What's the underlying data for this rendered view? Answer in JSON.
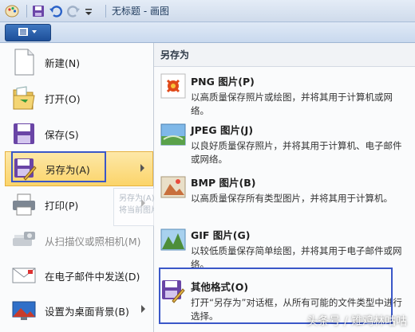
{
  "window": {
    "title": "无标题 - 画图"
  },
  "left_menu": {
    "items": [
      {
        "label": "新建(N)"
      },
      {
        "label": "打开(O)"
      },
      {
        "label": "保存(S)"
      },
      {
        "label": "另存为(A)"
      },
      {
        "label": "打印(P)"
      },
      {
        "label": "从扫描仪或照相机(M)"
      },
      {
        "label": "在电子邮件中发送(D)"
      },
      {
        "label": "设置为桌面背景(B)"
      }
    ],
    "ghost_tooltip": {
      "title": "另存为(A)",
      "text": "将当前图片另存为新文件。"
    }
  },
  "submenu": {
    "header": "另存为",
    "items": [
      {
        "title": "PNG 图片(P)",
        "desc": "以高质量保存照片或绘图，并将其用于计算机或网络。"
      },
      {
        "title": "JPEG 图片(J)",
        "desc": "以良好质量保存照片，并将其用于计算机、电子邮件或网络。"
      },
      {
        "title": "BMP 图片(B)",
        "desc": "以高质量保存所有类型图片，并将其用于计算机。"
      },
      {
        "title": "GIF 图片(G)",
        "desc": "以较低质量保存简单绘图，并将其用于电子邮件或网络。"
      },
      {
        "title": "其他格式(O)",
        "desc": "打开“另存为”对话框，从所有可能的文件类型中进行选择。"
      }
    ]
  },
  "watermark": "头条号 / 雉鸡林咕咕",
  "colors": {
    "highlight": "#fbd46a",
    "annotation_box": "#3a57c8",
    "ribbon": "#cfdbeb"
  }
}
